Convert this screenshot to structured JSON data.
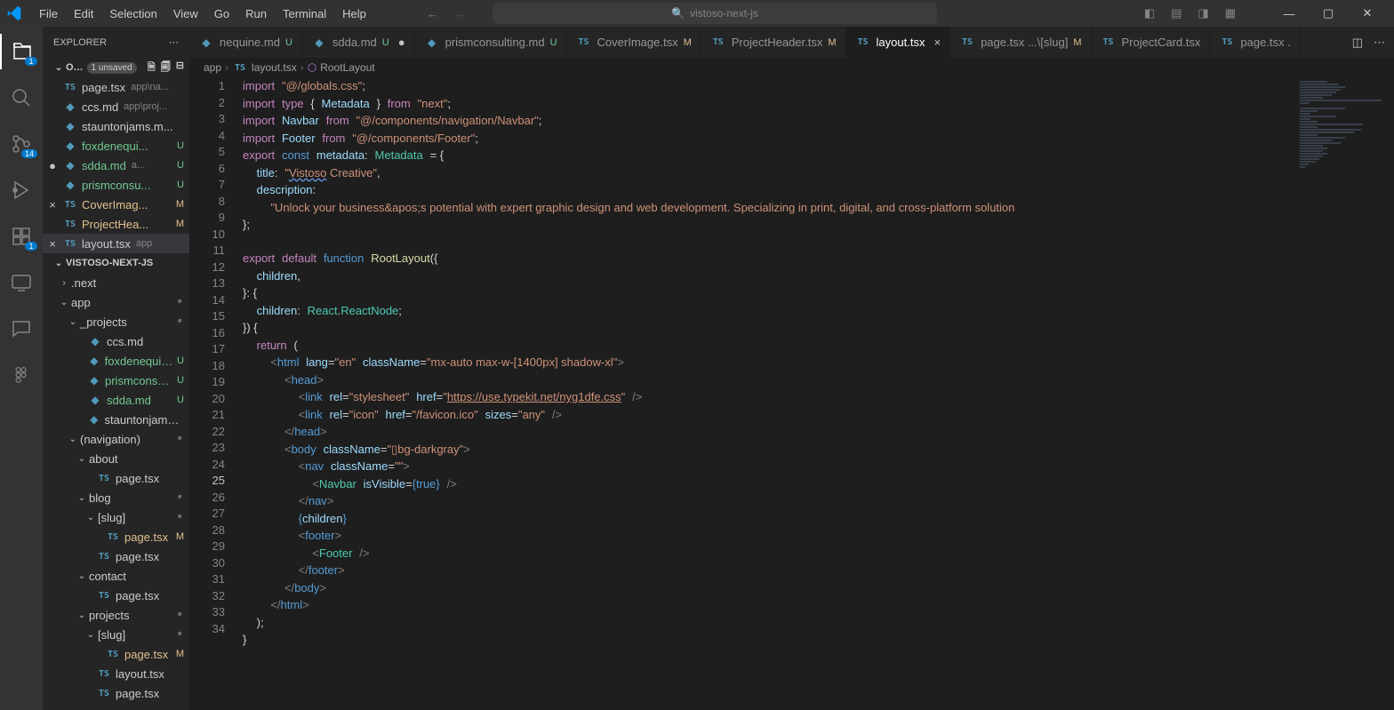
{
  "titlebar": {
    "menu": [
      "File",
      "Edit",
      "Selection",
      "View",
      "Go",
      "Run",
      "Terminal",
      "Help"
    ],
    "search_prefix": "",
    "search_text": "vistoso-next-js"
  },
  "activity": {
    "badges": {
      "explorer": "1",
      "scm": "14",
      "ext": "1"
    }
  },
  "sidebar": {
    "title": "EXPLORER",
    "open_editors_label": "O…",
    "unsaved": "1 unsaved",
    "open_editors": [
      {
        "icon": "ts",
        "name": "page.tsx",
        "dim": "app\\na...",
        "status": "",
        "left": ""
      },
      {
        "icon": "md",
        "name": "ccs.md",
        "dim": "app\\proj...",
        "status": "",
        "left": ""
      },
      {
        "icon": "md",
        "name": "stauntonjams.m...",
        "dim": "",
        "status": "",
        "left": ""
      },
      {
        "icon": "md",
        "name": "foxdenequi...",
        "dim": "",
        "status": "U",
        "left": ""
      },
      {
        "icon": "md",
        "name": "sdda.md",
        "dim": "a...",
        "status": "U",
        "left": "●"
      },
      {
        "icon": "md",
        "name": "prismconsu...",
        "dim": "",
        "status": "U",
        "left": ""
      },
      {
        "icon": "ts",
        "name": "CoverImag...",
        "dim": "",
        "status": "M",
        "left": "×",
        "active": false
      },
      {
        "icon": "ts",
        "name": "ProjectHea...",
        "dim": "",
        "status": "M",
        "left": ""
      },
      {
        "icon": "ts",
        "name": "layout.tsx",
        "dim": "app",
        "status": "",
        "left": "×",
        "active": true
      }
    ],
    "project": "VISTOSO-NEXT-JS",
    "tree": [
      {
        "indent": 1,
        "chev": ">",
        "type": "folder",
        "name": ".next"
      },
      {
        "indent": 1,
        "chev": "v",
        "type": "folder",
        "name": "app",
        "decor": "●"
      },
      {
        "indent": 2,
        "chev": "v",
        "type": "folder",
        "name": "_projects",
        "decor": "●"
      },
      {
        "indent": 3,
        "chev": "",
        "type": "md",
        "name": "ccs.md"
      },
      {
        "indent": 3,
        "chev": "",
        "type": "md",
        "name": "foxdenequine...",
        "status": "U"
      },
      {
        "indent": 3,
        "chev": "",
        "type": "md",
        "name": "prismconsulti...",
        "status": "U"
      },
      {
        "indent": 3,
        "chev": "",
        "type": "md",
        "name": "sdda.md",
        "status": "U"
      },
      {
        "indent": 3,
        "chev": "",
        "type": "md",
        "name": "stauntonjams.md"
      },
      {
        "indent": 2,
        "chev": "v",
        "type": "folder",
        "name": "(navigation)",
        "decor": "●"
      },
      {
        "indent": 3,
        "chev": "v",
        "type": "folder",
        "name": "about"
      },
      {
        "indent": 4,
        "chev": "",
        "type": "ts",
        "name": "page.tsx"
      },
      {
        "indent": 3,
        "chev": "v",
        "type": "folder",
        "name": "blog",
        "decor": "●"
      },
      {
        "indent": 4,
        "chev": "v",
        "type": "folder",
        "name": "[slug]",
        "decor": "●"
      },
      {
        "indent": 5,
        "chev": "",
        "type": "ts",
        "name": "page.tsx",
        "status": "M"
      },
      {
        "indent": 4,
        "chev": "",
        "type": "ts",
        "name": "page.tsx"
      },
      {
        "indent": 3,
        "chev": "v",
        "type": "folder",
        "name": "contact"
      },
      {
        "indent": 4,
        "chev": "",
        "type": "ts",
        "name": "page.tsx"
      },
      {
        "indent": 3,
        "chev": "v",
        "type": "folder",
        "name": "projects",
        "decor": "●"
      },
      {
        "indent": 4,
        "chev": "v",
        "type": "folder",
        "name": "[slug]",
        "decor": "●"
      },
      {
        "indent": 5,
        "chev": "",
        "type": "ts",
        "name": "page.tsx",
        "status": "M"
      },
      {
        "indent": 4,
        "chev": "",
        "type": "ts",
        "name": "layout.tsx"
      },
      {
        "indent": 4,
        "chev": "",
        "type": "ts",
        "name": "page.tsx"
      }
    ]
  },
  "tabs": [
    {
      "icon": "md",
      "name": "nequine.md",
      "status": "U",
      "close": ""
    },
    {
      "icon": "md",
      "name": "sdda.md",
      "status": "U",
      "close": "●"
    },
    {
      "icon": "md",
      "name": "prismconsulting.md",
      "status": "U",
      "close": ""
    },
    {
      "icon": "ts",
      "name": "CoverImage.tsx",
      "status": "M",
      "close": ""
    },
    {
      "icon": "ts",
      "name": "ProjectHeader.tsx",
      "status": "M",
      "close": ""
    },
    {
      "icon": "ts",
      "name": "layout.tsx",
      "status": "",
      "close": "×",
      "active": true
    },
    {
      "icon": "ts",
      "name": "page.tsx ...\\[slug]",
      "status": "M",
      "close": ""
    },
    {
      "icon": "ts",
      "name": "ProjectCard.tsx",
      "status": "",
      "close": ""
    },
    {
      "icon": "ts",
      "name": "page.tsx .",
      "status": "",
      "close": ""
    }
  ],
  "breadcrumb": [
    "app",
    "layout.tsx",
    "RootLayout"
  ],
  "code": {
    "current_line": 25,
    "total_lines": 34
  }
}
